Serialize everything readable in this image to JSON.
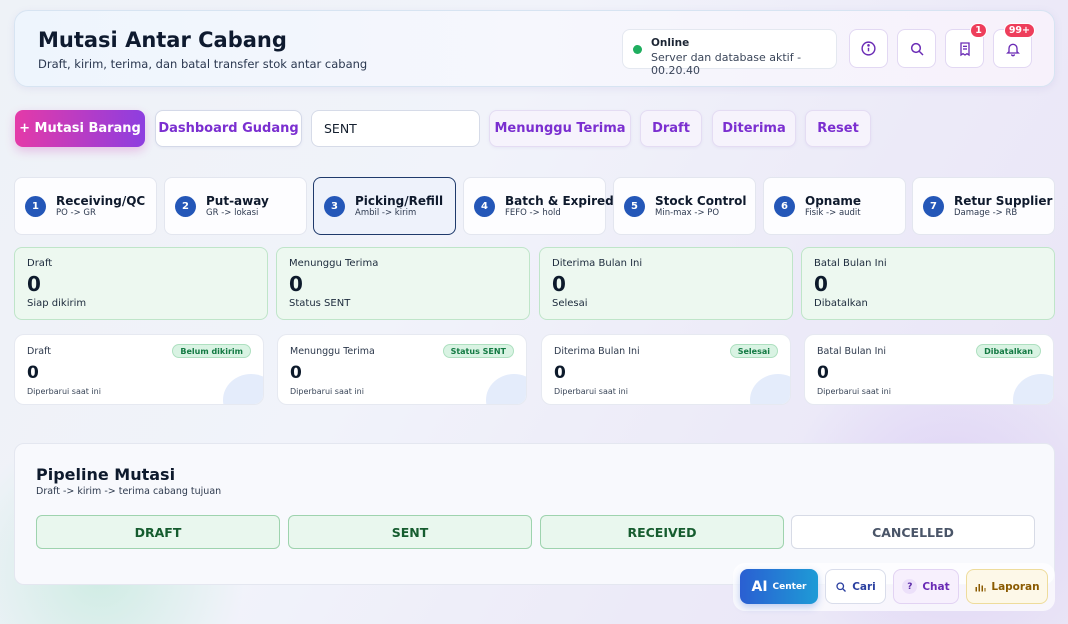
{
  "header": {
    "title": "Mutasi Antar Cabang",
    "subtitle": "Draft, kirim, terima, dan batal transfer stok antar cabang",
    "status_title": "Online",
    "status_text": "Server dan database aktif - 00.20.40",
    "status_color": "#1fae5f",
    "buttons": [
      {
        "icon": "info-icon"
      },
      {
        "icon": "search-icon"
      },
      {
        "icon": "receipt-icon",
        "badge": "1"
      },
      {
        "icon": "bell-icon",
        "badge": "99+"
      }
    ]
  },
  "toolbar": {
    "add_label": "+ Mutasi Barang",
    "dashboard_label": "Dashboard Gudang",
    "search_value": "SENT",
    "filters": [
      "Menunggu Terima",
      "Draft",
      "Diterima",
      "Reset"
    ]
  },
  "steps": [
    {
      "num": "1",
      "title": "Receiving/QC",
      "sub": "PO -> GR"
    },
    {
      "num": "2",
      "title": "Put-away",
      "sub": "GR -> lokasi"
    },
    {
      "num": "3",
      "title": "Picking/Refill",
      "sub": "Ambil -> kirim",
      "active": true
    },
    {
      "num": "4",
      "title": "Batch & Expired",
      "sub": "FEFO -> hold"
    },
    {
      "num": "5",
      "title": "Stock Control",
      "sub": "Min-max -> PO"
    },
    {
      "num": "6",
      "title": "Opname",
      "sub": "Fisik -> audit"
    },
    {
      "num": "7",
      "title": "Retur Supplier",
      "sub": "Damage -> RB"
    }
  ],
  "kpis": [
    {
      "label": "Draft",
      "value": "0",
      "sub": "Siap dikirim"
    },
    {
      "label": "Menunggu Terima",
      "value": "0",
      "sub": "Status SENT"
    },
    {
      "label": "Diterima Bulan Ini",
      "value": "0",
      "sub": "Selesai"
    },
    {
      "label": "Batal Bulan Ini",
      "value": "0",
      "sub": "Dibatalkan"
    }
  ],
  "cards": [
    {
      "label": "Draft",
      "value": "0",
      "sub": "Diperbarui saat ini",
      "badge": "Belum dikirim"
    },
    {
      "label": "Menunggu Terima",
      "value": "0",
      "sub": "Diperbarui saat ini",
      "badge": "Status SENT"
    },
    {
      "label": "Diterima Bulan Ini",
      "value": "0",
      "sub": "Diperbarui saat ini",
      "badge": "Selesai"
    },
    {
      "label": "Batal Bulan Ini",
      "value": "0",
      "sub": "Diperbarui saat ini",
      "badge": "Dibatalkan"
    }
  ],
  "pipeline": {
    "title": "Pipeline Mutasi",
    "subtitle": "Draft -> kirim -> terima cabang tujuan",
    "stages": [
      {
        "label": "DRAFT",
        "done": true
      },
      {
        "label": "SENT",
        "done": true
      },
      {
        "label": "RECEIVED",
        "done": true
      },
      {
        "label": "CANCELLED",
        "done": false
      }
    ]
  },
  "dock": {
    "ai_big": "AI",
    "ai_small": "Center",
    "search_label": "Cari",
    "chat_icon": "?",
    "chat_label": "Chat",
    "report_label": "Laporan"
  }
}
